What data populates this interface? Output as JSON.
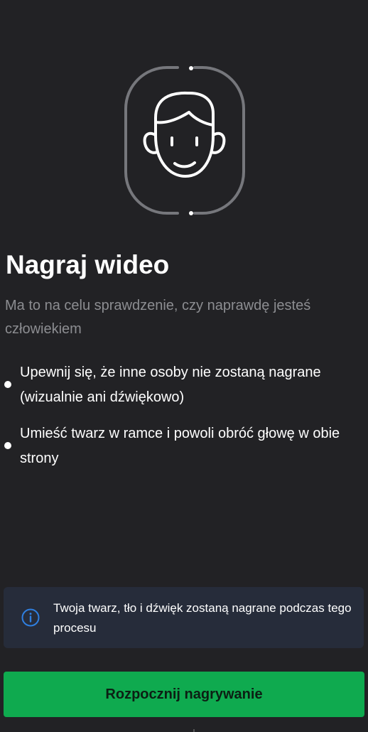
{
  "header": {
    "illustration_icon": "face-in-frame-icon"
  },
  "main": {
    "title": "Nagraj wideo",
    "subtitle": "Ma to na celu sprawdzenie, czy naprawdę jesteś człowiekiem",
    "instructions": [
      "Upewnij się, że inne osoby nie zostaną nagrane (wizualnie ani dźwiękowo)",
      "Umieść twarz w ramce i powoli obróć głowę w obie strony"
    ]
  },
  "info": {
    "icon": "info-icon",
    "text": "Twoja twarz, tło i dźwięk zostaną nagrane podczas tego procesu",
    "accent_color": "#2f7fe0",
    "background": "#262c3a"
  },
  "actions": {
    "start_recording_label": "Rozpocznij nagrywanie",
    "button_color": "#0faa4f"
  },
  "colors": {
    "background": "#222225",
    "subtitle_text": "#8c8d91",
    "frame_stroke": "#76777c"
  }
}
